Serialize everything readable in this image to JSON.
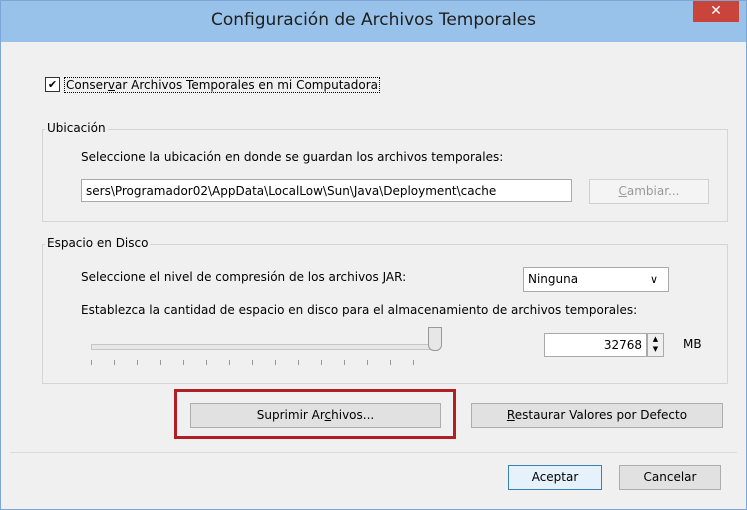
{
  "dialog": {
    "title": "Configuración de Archivos Temporales",
    "close_glyph": "✕"
  },
  "keep_files": {
    "checked": true,
    "label_pre": "Conser",
    "label_acc": "v",
    "label_post": "ar Archivos Temporales en mi Computadora"
  },
  "location": {
    "group_title": "Ubicación",
    "prompt": "Seleccione la ubicación en donde se guardan los archivos temporales:",
    "path": "sers\\Programador02\\AppData\\LocalLow\\Sun\\Java\\Deployment\\cache",
    "change_pre": "",
    "change_acc": "C",
    "change_post": "ambiar..."
  },
  "disk": {
    "group_title": "Espacio en Disco",
    "compression_prompt": "Seleccione el nivel de compresión de los archivos JAR:",
    "compression_value": "Ninguna",
    "space_prompt": "Establezca la cantidad de espacio en disco para el almacenamiento de archivos temporales:",
    "size_value": "32768",
    "unit": "MB"
  },
  "buttons": {
    "delete_pre": "Suprimir Ar",
    "delete_acc": "c",
    "delete_post": "hivos...",
    "restore_pre": "",
    "restore_acc": "R",
    "restore_post": "estaurar Valores por Defecto",
    "ok": "Aceptar",
    "cancel": "Cancelar"
  },
  "icons": {
    "checkbox": "check-icon",
    "dropdown": "chevron-down-icon",
    "spinner": "spinner-arrows-icon",
    "close": "close-icon"
  },
  "colors": {
    "titlebar": "#99c2ea",
    "close": "#c9443a",
    "highlight": "#b01f24"
  }
}
